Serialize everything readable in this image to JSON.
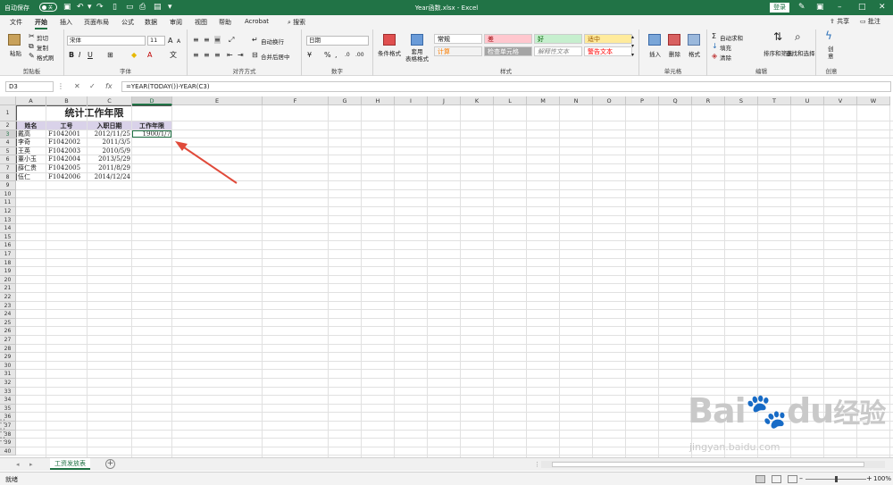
{
  "titlebar": {
    "autosave_label": "自动保存",
    "autosave_state": "关",
    "title": "Year函数.xlsx  -  Excel",
    "login": "登录"
  },
  "menu": {
    "tabs": [
      "文件",
      "开始",
      "插入",
      "页面布局",
      "公式",
      "数据",
      "审阅",
      "视图",
      "帮助",
      "Acrobat"
    ],
    "active": "开始",
    "search": "搜索",
    "share": "共享",
    "comment": "批注"
  },
  "ribbon": {
    "clipboard": {
      "paste": "粘贴",
      "cut": "剪切",
      "copy": "复制",
      "format_painter": "格式刷",
      "label": "剪贴板"
    },
    "font": {
      "name": "宋体",
      "size": "11",
      "label": "字体"
    },
    "alignment": {
      "wrap": "自动换行",
      "merge": "合并后居中",
      "label": "对齐方式"
    },
    "number": {
      "format": "日期",
      "label": "数字"
    },
    "styles": {
      "conditional": "条件格式",
      "table": "套用\n表格格式",
      "cells": [
        {
          "text": "常规",
          "bg": "#ffffff",
          "fg": "#000000"
        },
        {
          "text": "差",
          "bg": "#ffc7ce",
          "fg": "#9c0006"
        },
        {
          "text": "好",
          "bg": "#c6efce",
          "fg": "#006100"
        },
        {
          "text": "适中",
          "bg": "#ffeb9c",
          "fg": "#9c5700"
        },
        {
          "text": "计算",
          "bg": "#f2f2f2",
          "fg": "#fa7d00"
        },
        {
          "text": "检查单元格",
          "bg": "#a5a5a5",
          "fg": "#ffffff"
        },
        {
          "text": "解释性文本",
          "bg": "#ffffff",
          "fg": "#7f7f7f"
        },
        {
          "text": "警告文本",
          "bg": "#ffffff",
          "fg": "#ff0000"
        }
      ],
      "label": "样式"
    },
    "cells_group": {
      "insert": "插入",
      "delete": "删除",
      "format": "格式",
      "label": "单元格"
    },
    "editing": {
      "autosum": "自动求和",
      "fill": "填充",
      "clear": "清除",
      "sort": "排序和筛选",
      "find": "查找和选择",
      "label": "编辑"
    },
    "creative": {
      "create": "创\n意",
      "label": "创意"
    }
  },
  "formula": {
    "namebox": "D3",
    "fx": "fx",
    "value": "=YEAR(TODAY())-YEAR(C3)"
  },
  "columns": [
    "A",
    "B",
    "C",
    "D",
    "E",
    "F",
    "G",
    "H",
    "I",
    "J",
    "K",
    "L",
    "M",
    "N",
    "O",
    "P",
    "Q",
    "R",
    "S",
    "T",
    "U",
    "V",
    "W"
  ],
  "rows": [
    "1",
    "2",
    "3",
    "4",
    "5",
    "6",
    "7",
    "8",
    "9",
    "10",
    "11",
    "12",
    "13",
    "14",
    "15",
    "16",
    "17",
    "18",
    "19",
    "20",
    "21",
    "22",
    "23",
    "24",
    "25",
    "26",
    "27",
    "28",
    "29",
    "30",
    "31",
    "32",
    "33",
    "34",
    "35",
    "36",
    "37",
    "38",
    "39",
    "40"
  ],
  "table": {
    "title": "统计工作年限",
    "headers": [
      "姓名",
      "工号",
      "入职日期",
      "工作年限"
    ],
    "rows": [
      [
        "戴高",
        "F1042001",
        "2012/11/25",
        "1900/1/7"
      ],
      [
        "李奇",
        "F1042002",
        "2011/3/5",
        ""
      ],
      [
        "王英",
        "F1042003",
        "2010/5/9",
        ""
      ],
      [
        "董小玉",
        "F1042004",
        "2013/5/29",
        ""
      ],
      [
        "薛仁贵",
        "F1042005",
        "2011/8/29",
        ""
      ],
      [
        "伍仁",
        "F1042006",
        "2014/12/24",
        ""
      ]
    ]
  },
  "sheetbar": {
    "tab": "工资发放表"
  },
  "status": {
    "ready": "就绪",
    "zoom": "100%"
  },
  "watermark": {
    "brand": "Bai",
    "brand2": "du",
    "cn": "经验",
    "url": "jingyan.baidu.com"
  },
  "colors": {
    "excel_green": "#217346",
    "header_fill": "#d9d2e9",
    "arrow": "#e04a3a"
  }
}
